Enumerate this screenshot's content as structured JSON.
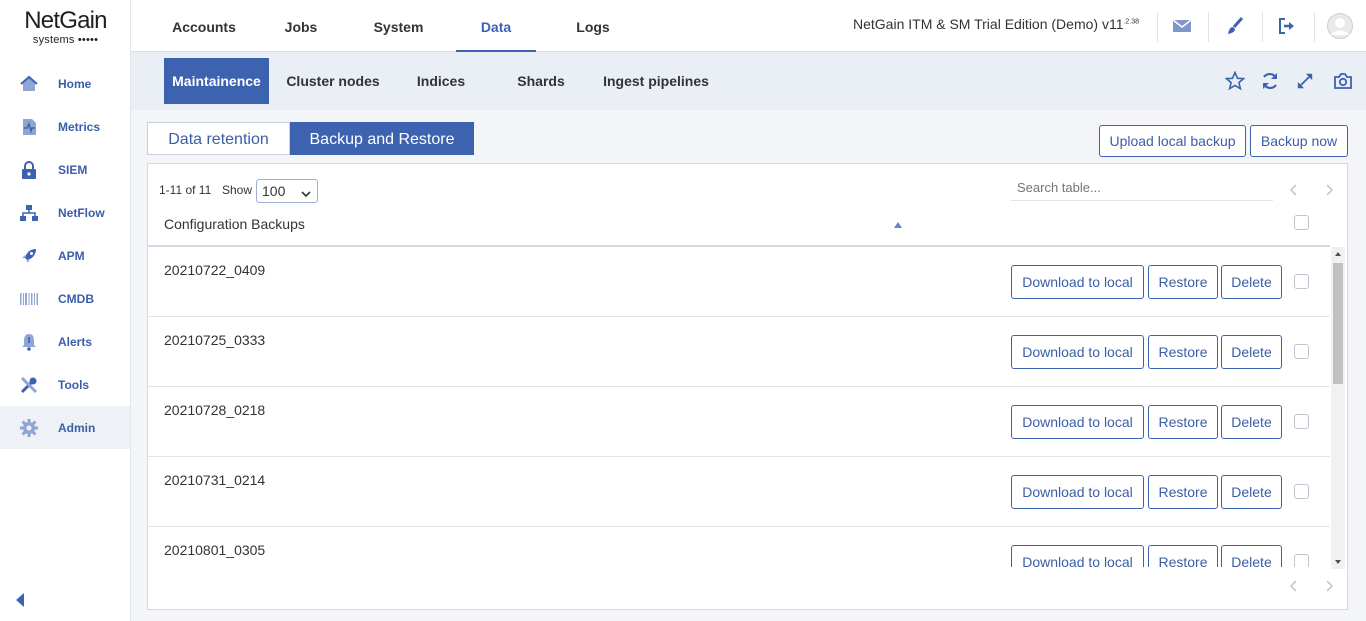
{
  "logo": {
    "main": "NetGain",
    "sub": "systems •••••"
  },
  "sidebar": {
    "items": [
      {
        "label": "Home",
        "icon": "home-icon"
      },
      {
        "label": "Metrics",
        "icon": "metrics-icon"
      },
      {
        "label": "SIEM",
        "icon": "lock-icon"
      },
      {
        "label": "NetFlow",
        "icon": "network-icon"
      },
      {
        "label": "APM",
        "icon": "rocket-icon"
      },
      {
        "label": "CMDB",
        "icon": "barcode-icon"
      },
      {
        "label": "Alerts",
        "icon": "bell-icon"
      },
      {
        "label": "Tools",
        "icon": "tools-icon"
      },
      {
        "label": "Admin",
        "icon": "gear-icon"
      }
    ],
    "active": "Admin"
  },
  "topnav": {
    "tabs": [
      "Accounts",
      "Jobs",
      "System",
      "Data",
      "Logs"
    ],
    "active": "Data",
    "edition": "NetGain ITM & SM Trial Edition (Demo) v11",
    "version_suffix": ".2.38"
  },
  "subnav": {
    "tabs": [
      "Maintainence",
      "Cluster nodes",
      "Indices",
      "Shards",
      "Ingest pipelines"
    ],
    "active": "Maintainence"
  },
  "content": {
    "inner_tabs": [
      "Data retention",
      "Backup and Restore"
    ],
    "active_inner_tab": "Backup and Restore",
    "upload_label": "Upload local backup",
    "backup_now_label": "Backup now"
  },
  "table": {
    "count": "1-11 of 11",
    "show_label": "Show",
    "show_value": "100",
    "search_placeholder": "Search table...",
    "column_header": "Configuration Backups",
    "download_label": "Download to local",
    "restore_label": "Restore",
    "delete_label": "Delete",
    "rows": [
      "20210722_0409",
      "20210725_0333",
      "20210728_0218",
      "20210731_0214",
      "20210801_0305"
    ]
  },
  "colors": {
    "accent": "#3d62b0",
    "subbar_bg": "#eaeef5",
    "content_bg": "#f3f5f9"
  }
}
